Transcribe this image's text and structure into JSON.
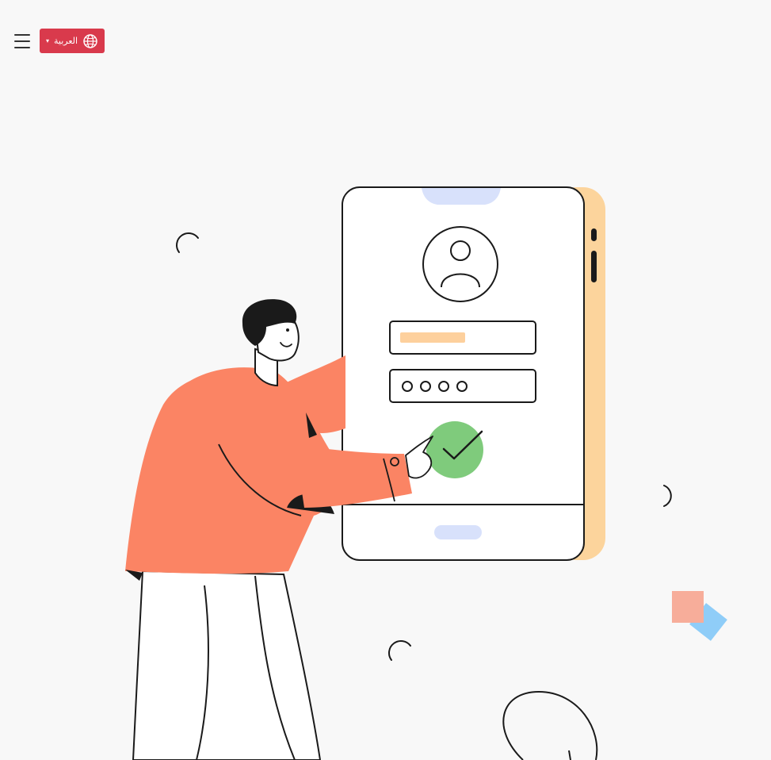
{
  "header": {
    "language_label": "العربية",
    "caret": "▾"
  },
  "icons": {
    "menu": "hamburger-menu-icon",
    "language": "language-globe-icon",
    "illustration": "login-verification-illustration"
  },
  "colors": {
    "page_background": "#f8f8f8",
    "language_button": "#d93a4c",
    "shirt": "#fb8464",
    "check_badge": "#7fcb7c",
    "phone_side": "#fcd49c",
    "username_bar": "#fdd09d",
    "notch": "#d8e1fb",
    "square_salmon": "#f7ad9a",
    "square_blue": "#8fcdf8",
    "outline": "#1a1a1a"
  }
}
